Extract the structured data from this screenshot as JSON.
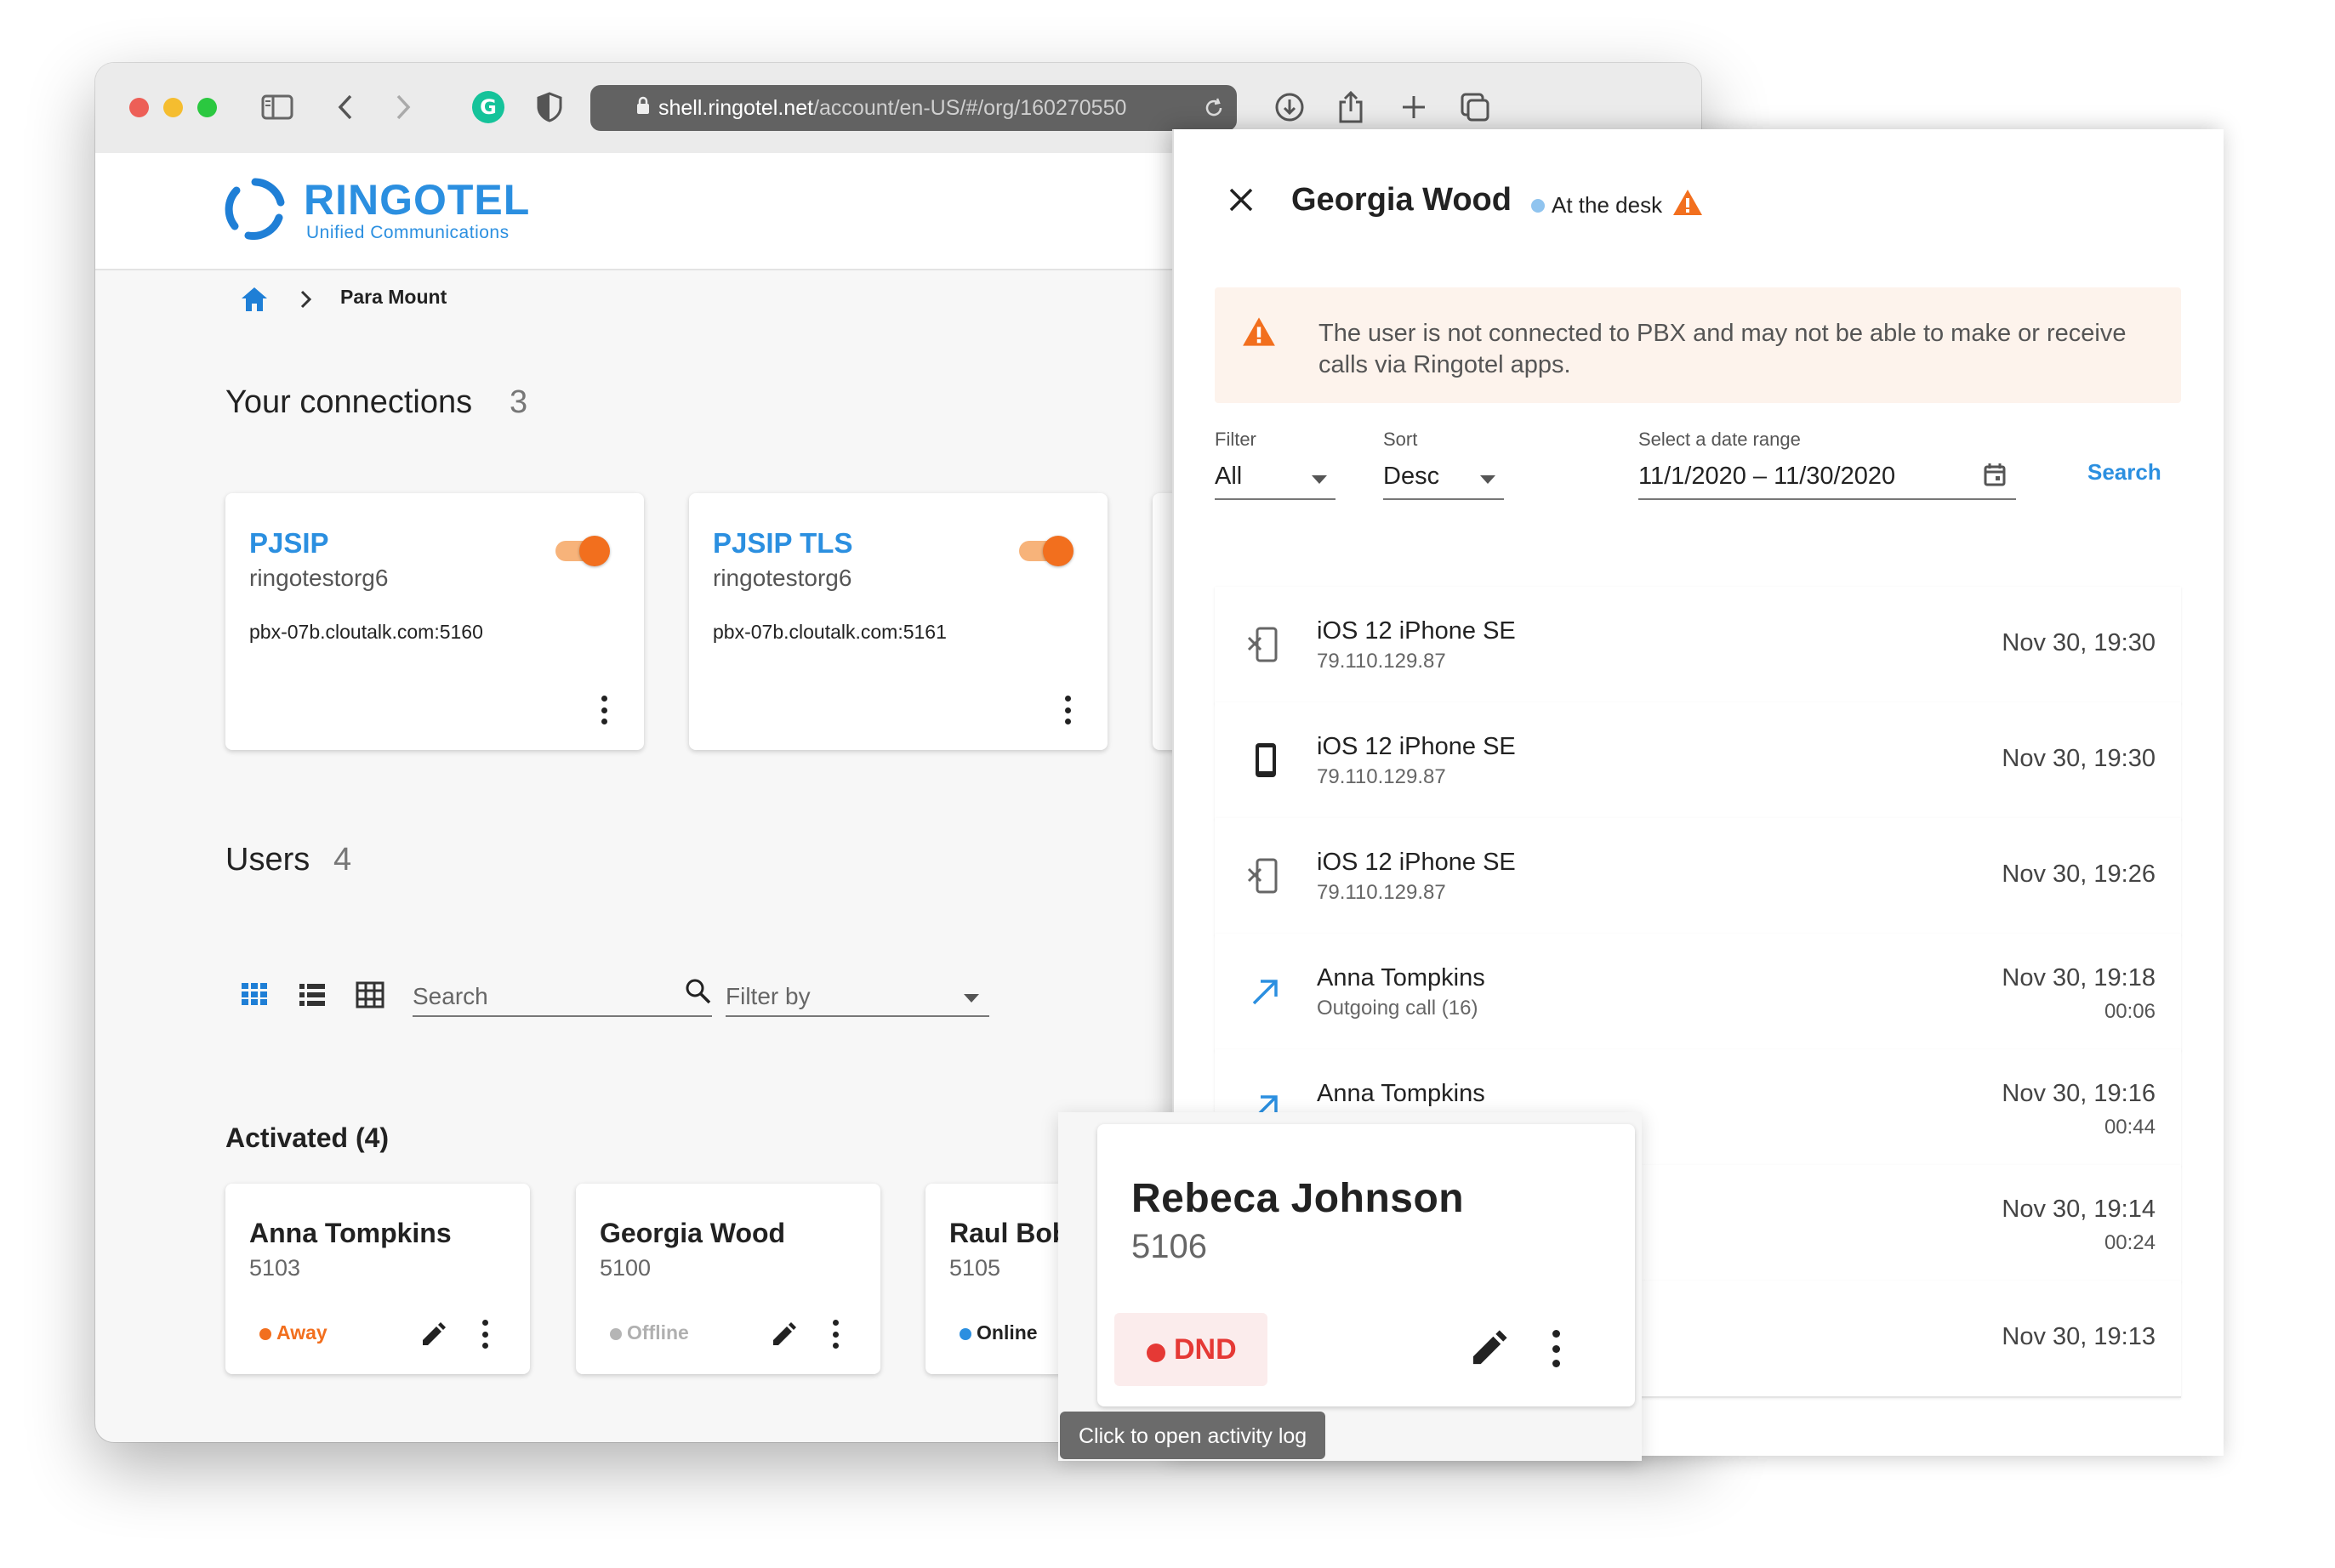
{
  "browser": {
    "url_host": "shell.ringotel.net",
    "url_path": "/account/en-US/#/org/160270550"
  },
  "brand": {
    "name": "RINGOTEL",
    "tagline": "Unified Communications",
    "accent": "#2b8fe0",
    "orange": "#f26f1e"
  },
  "breadcrumb": {
    "home_icon": "home-icon",
    "current": "Para Mount"
  },
  "connections": {
    "title": "Your connections",
    "count": "3",
    "items": [
      {
        "name": "PJSIP",
        "org": "ringotestorg6",
        "host": "pbx-07b.cloutalk.com:5160",
        "enabled": true
      },
      {
        "name": "PJSIP TLS",
        "org": "ringotestorg6",
        "host": "pbx-07b.cloutalk.com:5161",
        "enabled": true
      }
    ]
  },
  "users": {
    "title": "Users",
    "count": "4",
    "search_placeholder": "Search",
    "filter_placeholder": "Filter by",
    "activated_label": "Activated (4)",
    "cards": [
      {
        "name": "Anna Tompkins",
        "ext": "5103",
        "status": "Away",
        "status_color": "#f26f1e"
      },
      {
        "name": "Georgia Wood",
        "ext": "5100",
        "status": "Offline",
        "status_color": "#b5b5b5"
      },
      {
        "name": "Raul Bob",
        "ext": "5105",
        "status": "Online",
        "status_color": "#2b8fe0"
      }
    ]
  },
  "popup": {
    "name": "Rebeca Johnson",
    "ext": "5106",
    "status": "DND",
    "status_color": "#e53935",
    "tooltip": "Click to open activity log"
  },
  "panel": {
    "user_name": "Georgia Wood",
    "presence": "At the desk",
    "presence_color": "#90c4ef",
    "warning": "The user is not connected to PBX and may not be able to make or receive calls via Ringotel apps.",
    "filter_label": "Filter",
    "filter_value": "All",
    "sort_label": "Sort",
    "sort_value": "Desc",
    "date_label": "Select a date range",
    "date_value": "11/1/2020 – 11/30/2020",
    "search_button": "Search",
    "rows": [
      {
        "icon": "phone-disconnected-icon",
        "title": "iOS 12 iPhone SE",
        "sub": "79.110.129.87",
        "date": "Nov 30, 19:30",
        "dur": ""
      },
      {
        "icon": "phone-device-icon",
        "title": "iOS 12 iPhone SE",
        "sub": "79.110.129.87",
        "date": "Nov 30, 19:30",
        "dur": ""
      },
      {
        "icon": "phone-disconnected-icon",
        "title": "iOS 12 iPhone SE",
        "sub": "79.110.129.87",
        "date": "Nov 30, 19:26",
        "dur": ""
      },
      {
        "icon": "outgoing-call-icon",
        "title": "Anna Tompkins",
        "sub": "Outgoing call (16)",
        "date": "Nov 30, 19:18",
        "dur": "00:06"
      },
      {
        "icon": "outgoing-call-icon",
        "title": "Anna Tompkins",
        "sub": "",
        "date": "Nov 30, 19:16",
        "dur": "00:44"
      },
      {
        "icon": "",
        "title": "",
        "sub": "",
        "date": "Nov 30, 19:14",
        "dur": "00:24"
      },
      {
        "icon": "",
        "title": "",
        "sub": "",
        "date": "Nov 30, 19:13",
        "dur": ""
      }
    ]
  }
}
